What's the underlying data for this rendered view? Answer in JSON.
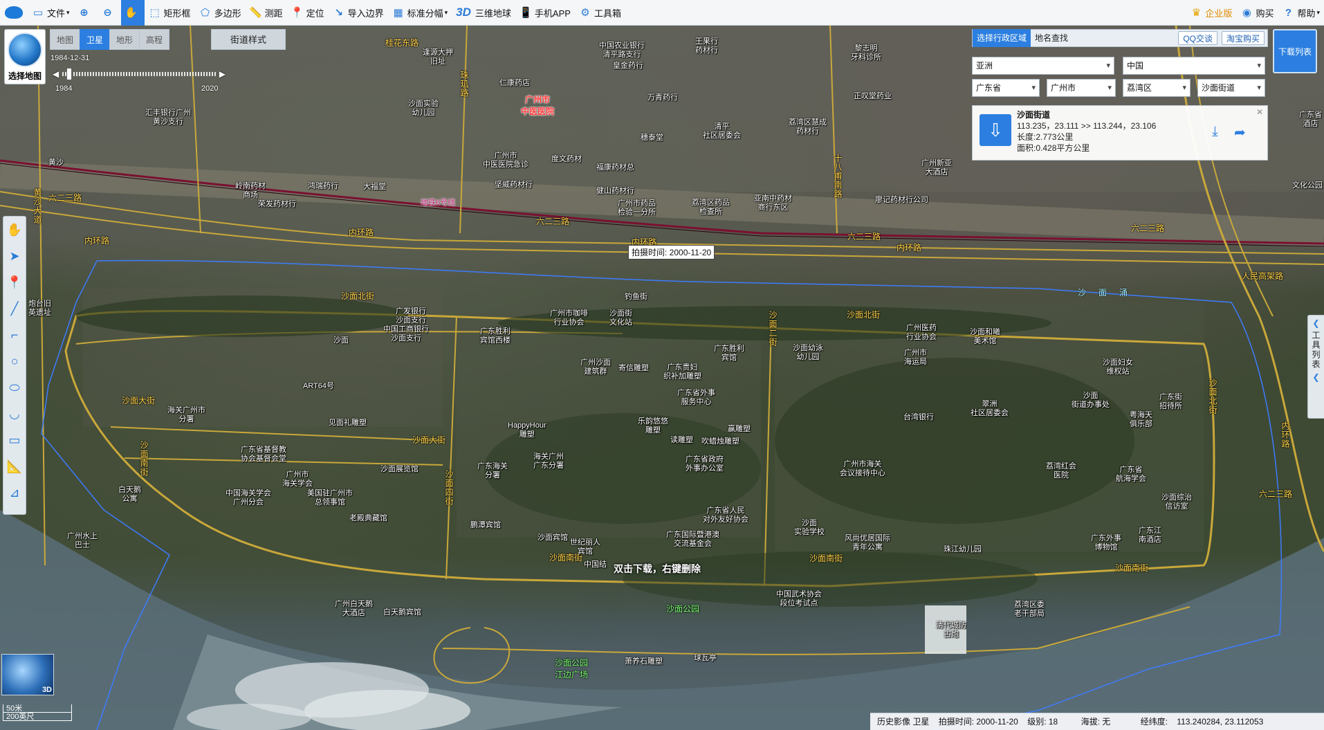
{
  "toolbar": {
    "file": "文件",
    "rect": "矩形框",
    "polygon": "多边形",
    "measure": "测距",
    "locate": "定位",
    "import_boundary": "导入边界",
    "grid": "标准分幅",
    "three_d_tag": "3D",
    "three_d": "三维地球",
    "mobile": "手机APP",
    "toolbox": "工具箱",
    "enterprise": "企业版",
    "buy": "购买",
    "help": "帮助"
  },
  "maptype": {
    "caption": "选择地图"
  },
  "tabs": [
    "地图",
    "卫星",
    "地形",
    "高程"
  ],
  "street_style": "街道样式",
  "timeline": {
    "current": "1984-12-31",
    "start": "1984",
    "end": "2020"
  },
  "right_panel": {
    "tab_region": "选择行政区域",
    "tab_search": "地名查找",
    "qq": "QQ交谈",
    "taobao": "淘宝购买",
    "download_list": "下载列表",
    "continent": "亚洲",
    "country": "中国",
    "province": "广东省",
    "city": "广州市",
    "district": "荔湾区",
    "street": "沙面街道",
    "result_name": "沙面街道",
    "result_coords": "113.235，23.111 >> 113.244，23.106",
    "result_length": "长度:2.773公里",
    "result_area": "面积:0.428平方公里"
  },
  "tool_list": "工具列表",
  "shot_tip": "拍摄时间: 2000-11-20",
  "hint": "双击下载，右键删除",
  "scale": {
    "metric": "50米",
    "imperial": "200英尺"
  },
  "status": {
    "layer": "历史影像 卫星",
    "shot": "拍摄时间: 2000-11-20",
    "level": "级别: 18",
    "altitude": "海拔: 无",
    "lnglat_label": "经纬度:",
    "lnglat": "113.240284, 23.112053"
  },
  "map": {
    "roads": {
      "r1": "六二三路",
      "r2": "六二三路",
      "r3": "六二三路",
      "r4": "六二三路",
      "r5": "六二三路",
      "r6": "内环路",
      "r7": "内环路",
      "r8": "内环路",
      "r9": "内环路",
      "r10": "内环路",
      "r11": "沙面北街",
      "r12": "沙面北街",
      "r13": "沙面大街",
      "r14": "沙面大街",
      "r15": "沙面南街",
      "r16": "沙面南街",
      "r17": "沙面南街",
      "r18": "沙面南街",
      "r19": "人民高架路",
      "r20": "桂花东路",
      "r21": "珠玑路",
      "r22": "十八甫南路",
      "r23": "沙面二街",
      "r24": "沙面四街",
      "r25": "沙面北街",
      "r26": "黄沙大道"
    },
    "areas": {
      "park": "沙面公园",
      "square": "沙面公园\n江边广场"
    },
    "water": "沙面涌",
    "metro": "地铁6号线",
    "hospital": "广州市\n中医医院",
    "labels": {
      "l1": "中国农业银行\n清平路支行",
      "l2": "王果行\n药材行",
      "l3": "逢源大押\n旧址",
      "l4": "仁康药店",
      "l5": "沙面实验\n幼儿园",
      "l6": "皇金药行",
      "l7": "万青药行",
      "l8": "汇丰银行广州\n黄沙支行",
      "l9": "黎志明\n牙科诊所",
      "l10": "正叹堂药业",
      "l11": "荔湾区慧成\n药材行",
      "l12": "清平\n社区居委会",
      "l13": "穗泰堂",
      "l14": "广州市\n中医医院急诊",
      "l15": "度文药材",
      "l16": "福康药材总",
      "l17": "坚威药材行",
      "l18": "健山药材行",
      "l19": "广州新亚\n大酒店",
      "l20": "岭南药材\n商场",
      "l21": "鸿瑞药行",
      "l22": "大福堂",
      "l23": "荣发药材行",
      "l24": "广州市药品\n检验一分所",
      "l25": "荔湾区药品\n检查所",
      "l26": "亚南中药材\n商行东区",
      "l27": "廖记药材行公司",
      "l28": "黄沙",
      "l29": "广发银行\n沙面支行",
      "l30": "中国工商银行\n沙面支行",
      "l31": "沙面",
      "l32": "钓鱼街",
      "l33": "广州市咖啡\n行业协会",
      "l34": "广东胜利\n宾馆西楼",
      "l35": "沙面街\n文化站",
      "l36": "广东胜利\n宾馆",
      "l37": "广州医药\n行业协会",
      "l38": "沙面和曦\n美术馆",
      "l39": "沙面幼泳\n幼儿园",
      "l40": "广州市\n海运局",
      "l41": "沙面妇女\n维权站",
      "l42": "ART64号",
      "l43": "广州沙面\n建筑群",
      "l44": "寄信雕塑",
      "l45": "广东贵妇\n织补加雕塑",
      "l46": "广东省外事\n服务中心",
      "l47": "台湾银行",
      "l48": "翠洲\n社区居委会",
      "l49": "沙面\n街道办事处",
      "l50": "广东街\n招待所",
      "l51": "粤海天\n俱乐部",
      "l52": "海关广州市\n分署",
      "l53": "见面礼雕塑",
      "l54": "HappyHour\n雕塑",
      "l55": "乐韵悠悠\n雕塑",
      "l56": "赢雕塑",
      "l57": "读雕塑",
      "l58": "吹蜡烛雕塑",
      "l59": "广东省基督教\n协会基督会堂",
      "l60": "沙面展览馆",
      "l61": "广东海关\n分署",
      "l62": "海关广州\n广东分署",
      "l63": "广东省政府\n外事办公室",
      "l64": "广州市海关\n会议接待中心",
      "l65": "荔湾红会\n医院",
      "l66": "广东省\n航海学会",
      "l67": "广州市\n海关学会",
      "l68": "中国海关学会\n广州分会",
      "l69": "美国驻广州市\n总领事馆",
      "l70": "老殿典藏馆",
      "l71": "鹏潭宾馆",
      "l72": "沙面宾馆",
      "l73": "世纪丽人\n宾馆",
      "l74": "广东省人民\n对外友好协会",
      "l75": "广东国际暨港澳\n交流基金会",
      "l76": "沙面\n实验学校",
      "l77": "风尚优居国际\n青年公寓",
      "l78": "珠江幼儿园",
      "l79": "广东外事\n博物馆",
      "l80": "广东江\n南酒店",
      "l81": "沙面综治\n信访室",
      "l82": "白天鹅\n公寓",
      "l83": "广州水上\n巴士",
      "l84": "广州白天鹅\n大酒店",
      "l85": "白天鹅宾馆",
      "l86": "中国结",
      "l87": "中国武术协会\n段位考试点",
      "l88": "荔湾区委\n老干部局",
      "l89": "清代城防\n古炮",
      "l90": "萧养石雕塑",
      "l91": "球瓦亭",
      "l92": "炮台旧\n英遗址",
      "l93": "广东省\n酒店",
      "l94": "文化公园"
    }
  }
}
